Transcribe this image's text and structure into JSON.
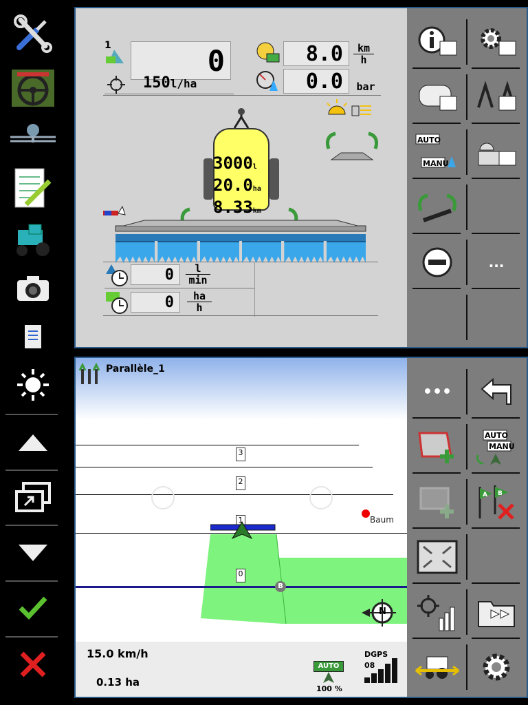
{
  "top_panel": {
    "applied_volume": "0",
    "rate": "150",
    "rate_unit": "l/ha",
    "speed": "8.0",
    "speed_unit_top": "km",
    "speed_unit_bottom": "h",
    "pressure": "0.0",
    "pressure_unit": "bar",
    "tank_volume": "3000",
    "tank_volume_unit": "l",
    "tank_area": "20.0",
    "tank_area_unit": "ha",
    "tank_distance": "8.33",
    "tank_distance_unit": "km",
    "flow": "0",
    "flow_unit_top": "l",
    "flow_unit_bottom": "min",
    "area_rate": "0",
    "area_rate_unit_top": "ha",
    "area_rate_unit_bottom": "h",
    "more_label": "...",
    "section_badge": "1"
  },
  "map_panel": {
    "track_name": "Parallèle_1",
    "line_labels": [
      "3",
      "2",
      "1",
      "0"
    ],
    "point_b": "B",
    "obstacle_label": "Baum",
    "compass": "N",
    "speed": "15.0 km/h",
    "area": "0.13 ha",
    "auto_label": "AUTO",
    "auto_percent": "100 %",
    "gps_type": "DGPS",
    "gps_count": "08",
    "more_label": "•••",
    "auto_manu_top": "AUTO",
    "auto_manu_bottom": "MANU",
    "flag_a": "A",
    "flag_b": "B"
  },
  "colors": {
    "accent": "#2a5a8a",
    "coverage": "#7ef37e",
    "tank": "#ffff66",
    "nozzle": "#3aa7ea"
  }
}
